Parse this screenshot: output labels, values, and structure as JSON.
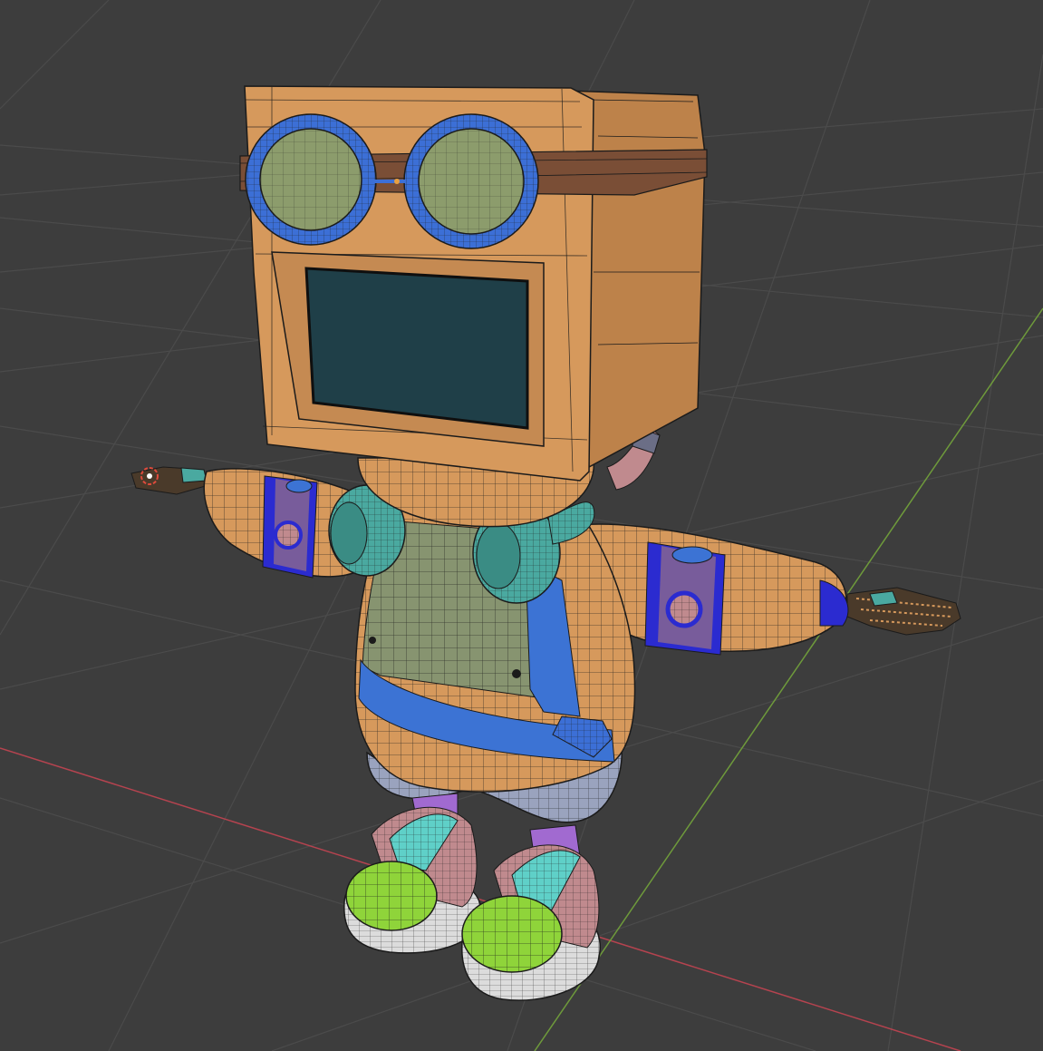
{
  "app": {
    "viewport_label": "",
    "mode": "edit-wireframe"
  },
  "colors": {
    "background": "#3d3d3d",
    "grid_line": "#4b4b4b",
    "x_axis": "#b5434f",
    "y_axis": "#6e9a3b",
    "wire": "#1b1b1b",
    "head_orange": "#d6995c",
    "head_dark": "#bd824a",
    "goggle_blue": "#3c6fd6",
    "lens_green": "#8c9c6c",
    "strap_brown": "#7a4e36",
    "screen": "#1f3f48",
    "headphone_teal": "#4aa9a0",
    "shirt_green": "#879470",
    "trim_blue": "#3c73d4",
    "band_blue": "#2b2bd0",
    "shorts_grey": "#9aa3be",
    "sock_purple": "#a16ad0",
    "shoe_pink": "#c08a8e",
    "shoe_cyan": "#5fd0c8",
    "toe_green": "#8fd43a",
    "sole_white": "#dcdcdc",
    "origin_cursor": "#e04b3c"
  },
  "objects": [
    {
      "name": "head-box",
      "icon": "cube-icon"
    },
    {
      "name": "goggles",
      "icon": "goggles-icon"
    },
    {
      "name": "screen-face",
      "icon": "screen-icon"
    },
    {
      "name": "headphones",
      "icon": "headphones-icon"
    },
    {
      "name": "body",
      "icon": "torso-icon"
    },
    {
      "name": "arms",
      "icon": "arm-icon"
    },
    {
      "name": "shoes",
      "icon": "shoe-icon"
    }
  ]
}
